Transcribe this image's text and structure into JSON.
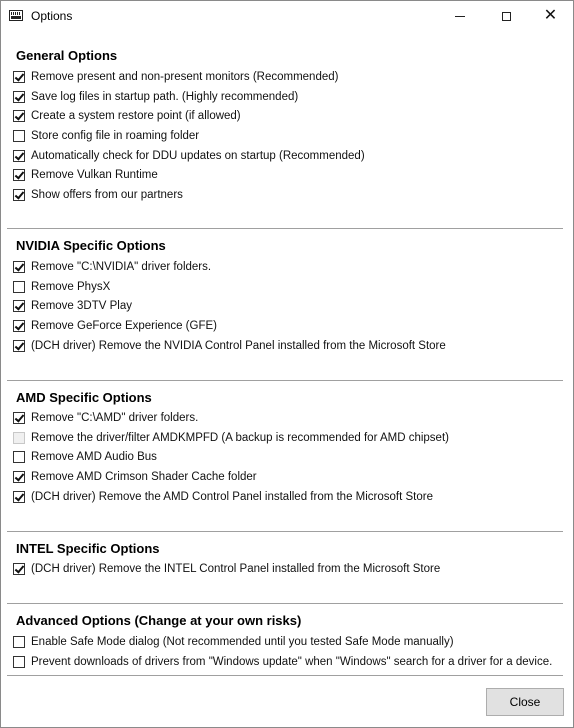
{
  "window": {
    "title": "Options",
    "minimize_glyph": "",
    "close_glyph": "✕"
  },
  "sections": {
    "general": {
      "title": "General Options",
      "items": [
        {
          "label": "Remove present and non-present monitors (Recommended)",
          "checked": true
        },
        {
          "label": "Save log files in startup path. (Highly recommended)",
          "checked": true
        },
        {
          "label": "Create a system restore point (if allowed)",
          "checked": true
        },
        {
          "label": "Store config file in roaming folder",
          "checked": false
        },
        {
          "label": "Automatically check for DDU updates on startup (Recommended)",
          "checked": true
        },
        {
          "label": "Remove Vulkan Runtime",
          "checked": true
        },
        {
          "label": "Show offers from our partners",
          "checked": true
        }
      ]
    },
    "nvidia": {
      "title": "NVIDIA Specific Options",
      "items": [
        {
          "label": "Remove \"C:\\NVIDIA\" driver folders.",
          "checked": true
        },
        {
          "label": "Remove PhysX",
          "checked": false
        },
        {
          "label": "Remove 3DTV Play",
          "checked": true
        },
        {
          "label": "Remove GeForce Experience (GFE)",
          "checked": true
        },
        {
          "label": "(DCH driver) Remove the NVIDIA Control Panel installed from the Microsoft Store",
          "checked": true
        }
      ]
    },
    "amd": {
      "title": "AMD Specific Options",
      "items": [
        {
          "label": "Remove \"C:\\AMD\" driver folders.",
          "checked": true
        },
        {
          "label": "Remove the driver/filter AMDKMPFD (A backup is recommended for AMD chipset)",
          "checked": false,
          "disabled": true
        },
        {
          "label": "Remove AMD Audio Bus",
          "checked": false
        },
        {
          "label": "Remove AMD Crimson Shader Cache folder",
          "checked": true
        },
        {
          "label": "(DCH driver) Remove the AMD Control Panel installed from the Microsoft Store",
          "checked": true
        }
      ]
    },
    "intel": {
      "title": "INTEL Specific Options",
      "items": [
        {
          "label": "(DCH driver) Remove the INTEL Control Panel installed from the Microsoft Store",
          "checked": true
        }
      ]
    },
    "advanced": {
      "title": "Advanced Options (Change at your own risks)",
      "items": [
        {
          "label": "Enable Safe Mode dialog (Not recommended until you tested Safe Mode manually)",
          "checked": false
        },
        {
          "label": "Prevent downloads of drivers from \"Windows update\" when \"Windows\" search for a driver for a device.",
          "checked": false
        }
      ]
    }
  },
  "footer": {
    "close_label": "Close"
  }
}
